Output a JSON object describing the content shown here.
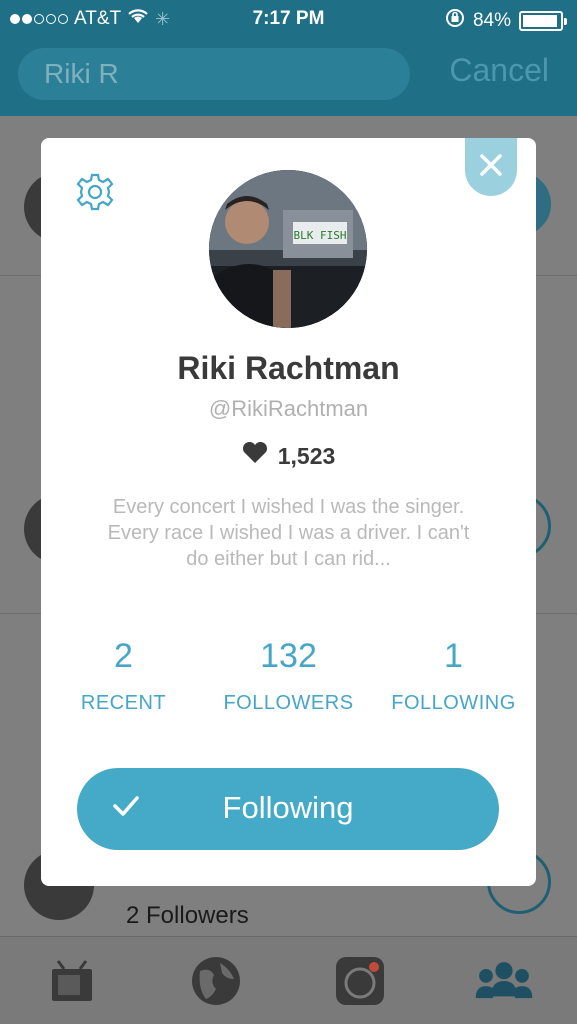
{
  "status_bar": {
    "carrier": "AT&T",
    "time": "7:17 PM",
    "battery_percent": "84%",
    "battery_level": 0.84,
    "signal_bars_filled": 2,
    "signal_bars_total": 5
  },
  "search": {
    "query": "Riki R",
    "cancel_label": "Cancel"
  },
  "background_list": {
    "rows": [
      {
        "followers": ""
      },
      {
        "followers": ""
      },
      {
        "followers": "2 Followers"
      }
    ]
  },
  "tab_bar": {
    "tabs": [
      {
        "icon": "tv-icon"
      },
      {
        "icon": "globe-icon"
      },
      {
        "icon": "camera-icon"
      },
      {
        "icon": "people-icon",
        "active": true
      }
    ]
  },
  "profile": {
    "name": "Riki Rachtman",
    "handle": "@RikiRachtman",
    "likes": "1,523",
    "bio": "Every concert I wished I was the singer. Every race I wished I was a driver. I can't do either but I can rid...",
    "stats": [
      {
        "value": "2",
        "label": "RECENT"
      },
      {
        "value": "132",
        "label": "FOLLOWERS"
      },
      {
        "value": "1",
        "label": "FOLLOWING"
      }
    ],
    "follow_button_label": "Following",
    "plate_text": "BLK FISH"
  },
  "colors": {
    "accent": "#45a9c8",
    "header": "#1f6f86",
    "close_tab": "#9bd0de"
  }
}
